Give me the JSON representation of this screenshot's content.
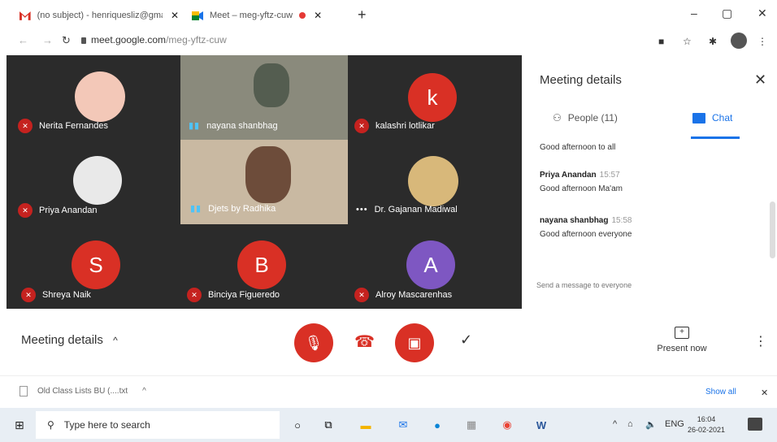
{
  "browser": {
    "tabs": [
      {
        "title": "(no subject) - henriquesliz@gma",
        "close": "✕"
      },
      {
        "title": "Meet – meg-yftz-cuw",
        "close": "✕",
        "recording": true
      }
    ],
    "new_tab": "+",
    "window_controls": {
      "minimize": "–",
      "maximize": "▢",
      "close": "✕"
    },
    "url_host": "meet.google.com",
    "url_path": "/meg-yftz-cuw"
  },
  "participants": [
    {
      "name": "Nerita Fernandes",
      "muted": true,
      "kind": "photo"
    },
    {
      "name": "nayana shanbhag",
      "muted": false,
      "kind": "video"
    },
    {
      "name": "kalashri lotlikar",
      "muted": true,
      "kind": "letter",
      "letter": "k",
      "color": "#d93025"
    },
    {
      "name": "Priya Anandan",
      "muted": true,
      "kind": "photo"
    },
    {
      "name": "Djets by Radhika",
      "muted": false,
      "kind": "video"
    },
    {
      "name": "Dr. Gajanan Madiwal",
      "muted": false,
      "kind": "photo"
    },
    {
      "name": "Shreya Naik",
      "muted": true,
      "kind": "letter",
      "letter": "S",
      "color": "#d93025"
    },
    {
      "name": "Binciya Figueredo",
      "muted": true,
      "kind": "letter",
      "letter": "B",
      "color": "#d93025"
    },
    {
      "name": "Alroy Mascarenhas",
      "muted": true,
      "kind": "letter",
      "letter": "A",
      "color": "#7e57c2"
    }
  ],
  "panel": {
    "title": "Meeting details",
    "close": "✕",
    "tab_people": "People (11)",
    "tab_chat": "Chat",
    "messages": [
      {
        "sender": "",
        "time": "",
        "text": "Good afternoon to all"
      },
      {
        "sender": "Priya Anandan",
        "time": "15:57",
        "text": "Good afternoon Ma'am"
      },
      {
        "sender": "nayana shanbhag",
        "time": "15:58",
        "text": "Good afternoon everyone"
      }
    ],
    "input_placeholder": "Send a message to everyone"
  },
  "controls": {
    "meeting_details": "Meeting details",
    "chevron": "^",
    "present_now": "Present now",
    "present_icon": "+",
    "check": "✓",
    "more": "⋮"
  },
  "downloads": {
    "file": "Old Class Lists BU (....txt",
    "chevron": "^",
    "show_all": "Show all",
    "close": "✕"
  },
  "taskbar": {
    "search_placeholder": "Type here to search",
    "lang": "ENG",
    "time": "16:04",
    "date": "26-02-2021"
  }
}
